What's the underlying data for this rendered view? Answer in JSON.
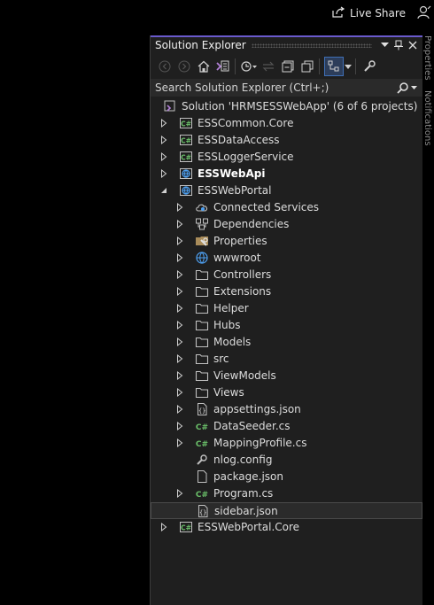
{
  "top_bar": {
    "live_share_label": "Live Share"
  },
  "side_tabs": {
    "tab1": "Properties",
    "tab2": "Notifications"
  },
  "solution_explorer": {
    "title": "Solution Explorer",
    "search_placeholder": "Search Solution Explorer (Ctrl+;)",
    "accent_color": "#6a5acd",
    "tree": [
      {
        "label": "Solution 'HRMSESSWebApp' (6 of 6 projects)",
        "icon": "solution-icon",
        "level": 0,
        "expander": "none"
      },
      {
        "label": "ESSCommon.Core",
        "icon": "csharp-project-icon",
        "level": 0,
        "expander": "collapsed"
      },
      {
        "label": "ESSDataAccess",
        "icon": "csharp-project-icon",
        "level": 0,
        "expander": "collapsed"
      },
      {
        "label": "ESSLoggerService",
        "icon": "csharp-project-icon",
        "level": 0,
        "expander": "collapsed"
      },
      {
        "label": "ESSWebApi",
        "icon": "web-project-icon",
        "level": 0,
        "expander": "collapsed",
        "bold": true
      },
      {
        "label": "ESSWebPortal",
        "icon": "web-project-icon",
        "level": 0,
        "expander": "expanded"
      },
      {
        "label": "Connected Services",
        "icon": "connected-services-icon",
        "level": 1,
        "expander": "collapsed"
      },
      {
        "label": "Dependencies",
        "icon": "dependencies-icon",
        "level": 1,
        "expander": "collapsed"
      },
      {
        "label": "Properties",
        "icon": "properties-icon",
        "level": 1,
        "expander": "collapsed"
      },
      {
        "label": "wwwroot",
        "icon": "globe-icon",
        "level": 1,
        "expander": "collapsed"
      },
      {
        "label": "Controllers",
        "icon": "folder-icon",
        "level": 1,
        "expander": "collapsed"
      },
      {
        "label": "Extensions",
        "icon": "folder-icon",
        "level": 1,
        "expander": "collapsed"
      },
      {
        "label": "Helper",
        "icon": "folder-icon",
        "level": 1,
        "expander": "collapsed"
      },
      {
        "label": "Hubs",
        "icon": "folder-icon",
        "level": 1,
        "expander": "collapsed"
      },
      {
        "label": "Models",
        "icon": "folder-icon",
        "level": 1,
        "expander": "collapsed"
      },
      {
        "label": "src",
        "icon": "folder-icon",
        "level": 1,
        "expander": "collapsed"
      },
      {
        "label": "ViewModels",
        "icon": "folder-icon",
        "level": 1,
        "expander": "collapsed"
      },
      {
        "label": "Views",
        "icon": "folder-icon",
        "level": 1,
        "expander": "collapsed"
      },
      {
        "label": "appsettings.json",
        "icon": "json-file-icon",
        "level": 1,
        "expander": "collapsed"
      },
      {
        "label": "DataSeeder.cs",
        "icon": "csharp-file-icon",
        "level": 1,
        "expander": "collapsed"
      },
      {
        "label": "MappingProfile.cs",
        "icon": "csharp-file-icon",
        "level": 1,
        "expander": "collapsed"
      },
      {
        "label": "nlog.config",
        "icon": "config-file-icon",
        "level": 1,
        "expander": "none"
      },
      {
        "label": "package.json",
        "icon": "file-icon",
        "level": 1,
        "expander": "none"
      },
      {
        "label": "Program.cs",
        "icon": "csharp-file-icon",
        "level": 1,
        "expander": "collapsed"
      },
      {
        "label": "sidebar.json",
        "icon": "json-file-icon",
        "level": 1,
        "expander": "none",
        "selected": true
      },
      {
        "label": "ESSWebPortal.Core",
        "icon": "csharp-project-icon",
        "level": 0,
        "expander": "collapsed"
      }
    ]
  }
}
